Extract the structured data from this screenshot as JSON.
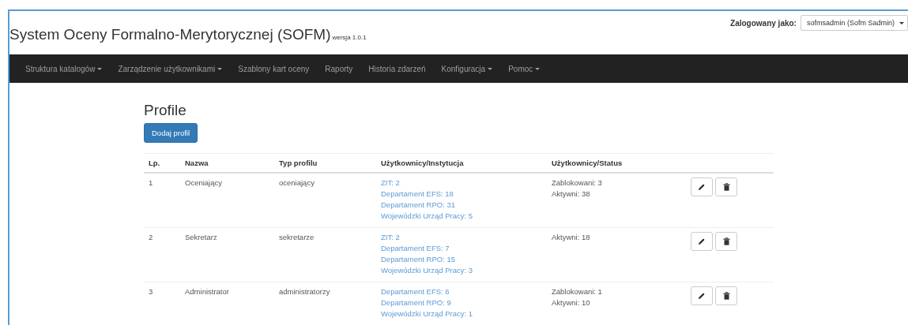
{
  "header": {
    "title": "System Oceny Formalno-Merytorycznej (SOFM)",
    "version": "wersja 1.0.1",
    "login_label": "Zalogowany jako:",
    "user": "sofmsadmin (Sofm Sadmin)"
  },
  "navbar": [
    {
      "label": "Struktura katalogów",
      "dropdown": true
    },
    {
      "label": "Zarządzenie użytkownikami",
      "dropdown": true
    },
    {
      "label": "Szablony kart oceny",
      "dropdown": false
    },
    {
      "label": "Raporty",
      "dropdown": false
    },
    {
      "label": "Historia zdarzeń",
      "dropdown": false
    },
    {
      "label": "Konfiguracja",
      "dropdown": true
    },
    {
      "label": "Pomoc",
      "dropdown": true
    }
  ],
  "page": {
    "title": "Profile",
    "add_button": "Dodaj profil"
  },
  "table": {
    "columns": [
      "Lp.",
      "Nazwa",
      "Typ profilu",
      "Użytkownicy/Instytucja",
      "Użytkownicy/Status"
    ],
    "rows": [
      {
        "index": "1",
        "name": "Oceniający",
        "type": "oceniający",
        "institutions": [
          "ZIT: 2",
          "Departament EFS: 18",
          "Departament RPO: 31",
          "Wojewódzki Urząd Pracy: 5"
        ],
        "status": [
          "Zablokowani: 3",
          "Aktywni: 38"
        ]
      },
      {
        "index": "2",
        "name": "Sekretarz",
        "type": "sekretarze",
        "institutions": [
          "ZIT: 2",
          "Departament EFS: 7",
          "Departament RPO: 15",
          "Wojewódzki Urząd Pracy: 3"
        ],
        "status": [
          "Aktywni: 18"
        ]
      },
      {
        "index": "3",
        "name": "Administrator",
        "type": "administratorzy",
        "institutions": [
          "Departament EFS: 6",
          "Departament RPO: 9",
          "Wojewódzki Urząd Pracy: 1"
        ],
        "status": [
          "Zablokowani: 1",
          "Aktywni: 10"
        ]
      }
    ]
  }
}
